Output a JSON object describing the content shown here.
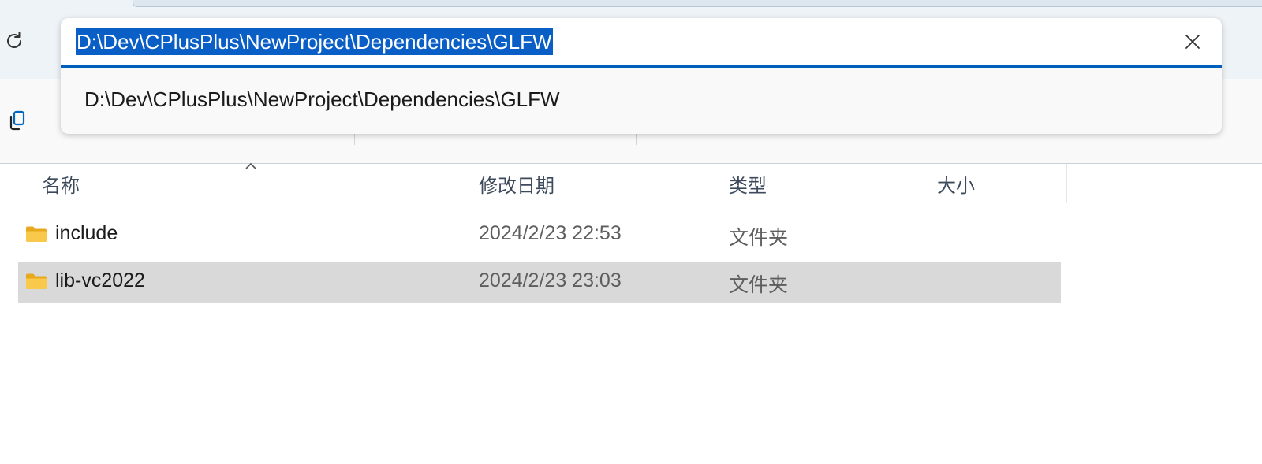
{
  "address_bar": {
    "value": "D:\\Dev\\CPlusPlus\\NewProject\\Dependencies\\GLFW",
    "suggestion": "D:\\Dev\\CPlusPlus\\NewProject\\Dependencies\\GLFW"
  },
  "icons": {
    "refresh": "refresh-icon",
    "clear": "close-icon",
    "copy": "copy-icon",
    "folder": "folder-icon",
    "sort": "chevron-up-icon"
  },
  "columns": {
    "name": "名称",
    "modified": "修改日期",
    "type": "类型",
    "size": "大小"
  },
  "files": [
    {
      "name": "include",
      "modified": "2024/2/23 22:53",
      "type": "文件夹",
      "size": "",
      "selected": false
    },
    {
      "name": "lib-vc2022",
      "modified": "2024/2/23 23:03",
      "type": "文件夹",
      "size": "",
      "selected": true
    }
  ],
  "colors": {
    "accent": "#005fb8",
    "selection_highlight": "#0a5fc7",
    "row_selected": "#d9d9d9",
    "folder_yellow": "#f6c343"
  }
}
